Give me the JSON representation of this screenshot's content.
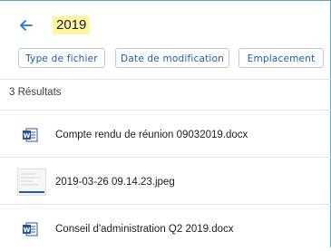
{
  "search": {
    "query": "2019"
  },
  "filters": [
    {
      "label": "Type de fichier"
    },
    {
      "label": "Date de modification"
    },
    {
      "label": "Emplacement"
    }
  ],
  "results": {
    "count_label": "3 Résultats",
    "items": [
      {
        "name": "Compte rendu de réunion 09032019.docx",
        "icon": "word-doc-icon"
      },
      {
        "name": "2019-03-26 09.14.23.jpeg",
        "icon": "image-thumbnail"
      },
      {
        "name": "Conseil d'administration Q2 2019.docx",
        "icon": "word-doc-icon"
      }
    ]
  },
  "colors": {
    "accent": "#1a73e8",
    "highlight": "#fff59d",
    "word": "#2b579a"
  }
}
